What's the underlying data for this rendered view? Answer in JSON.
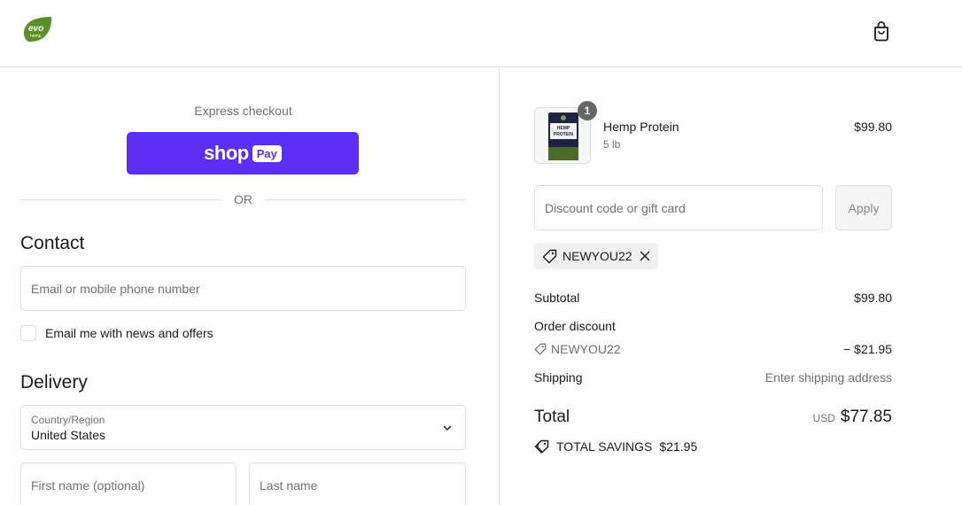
{
  "header": {
    "logo_text": "evo",
    "logo_subtext": "hemp",
    "cart_icon": "shopping-bag-icon"
  },
  "express": {
    "title": "Express checkout",
    "shop_pay_word": "shop",
    "shop_pay_badge": "Pay",
    "or_text": "OR"
  },
  "contact": {
    "heading": "Contact",
    "email_placeholder": "Email or mobile phone number",
    "newsletter_label": "Email me with news and offers"
  },
  "delivery": {
    "heading": "Delivery",
    "country_label": "Country/Region",
    "country_value": "United States",
    "first_name_placeholder": "First name (optional)",
    "last_name_placeholder": "Last name"
  },
  "cart": {
    "item": {
      "name": "Hemp Protein",
      "variant": "5 lb",
      "price": "$99.80",
      "quantity": "1",
      "thumb_text_1": "HEMP",
      "thumb_text_2": "PROTEIN"
    },
    "discount_placeholder": "Discount code or gift card",
    "apply_label": "Apply",
    "applied_code": "NEWYOU22"
  },
  "summary": {
    "subtotal_label": "Subtotal",
    "subtotal_value": "$99.80",
    "order_discount_label": "Order discount",
    "discount_code": "NEWYOU22",
    "discount_value": "− $21.95",
    "shipping_label": "Shipping",
    "shipping_value": "Enter shipping address",
    "total_label": "Total",
    "currency": "USD",
    "total_value": "$77.85",
    "savings_label": "TOTAL SAVINGS",
    "savings_value": "$21.95"
  },
  "colors": {
    "shop_pay": "#5a31f4",
    "logo_green": "#5a8f2a",
    "border": "#dedede",
    "muted_text": "#707070"
  }
}
